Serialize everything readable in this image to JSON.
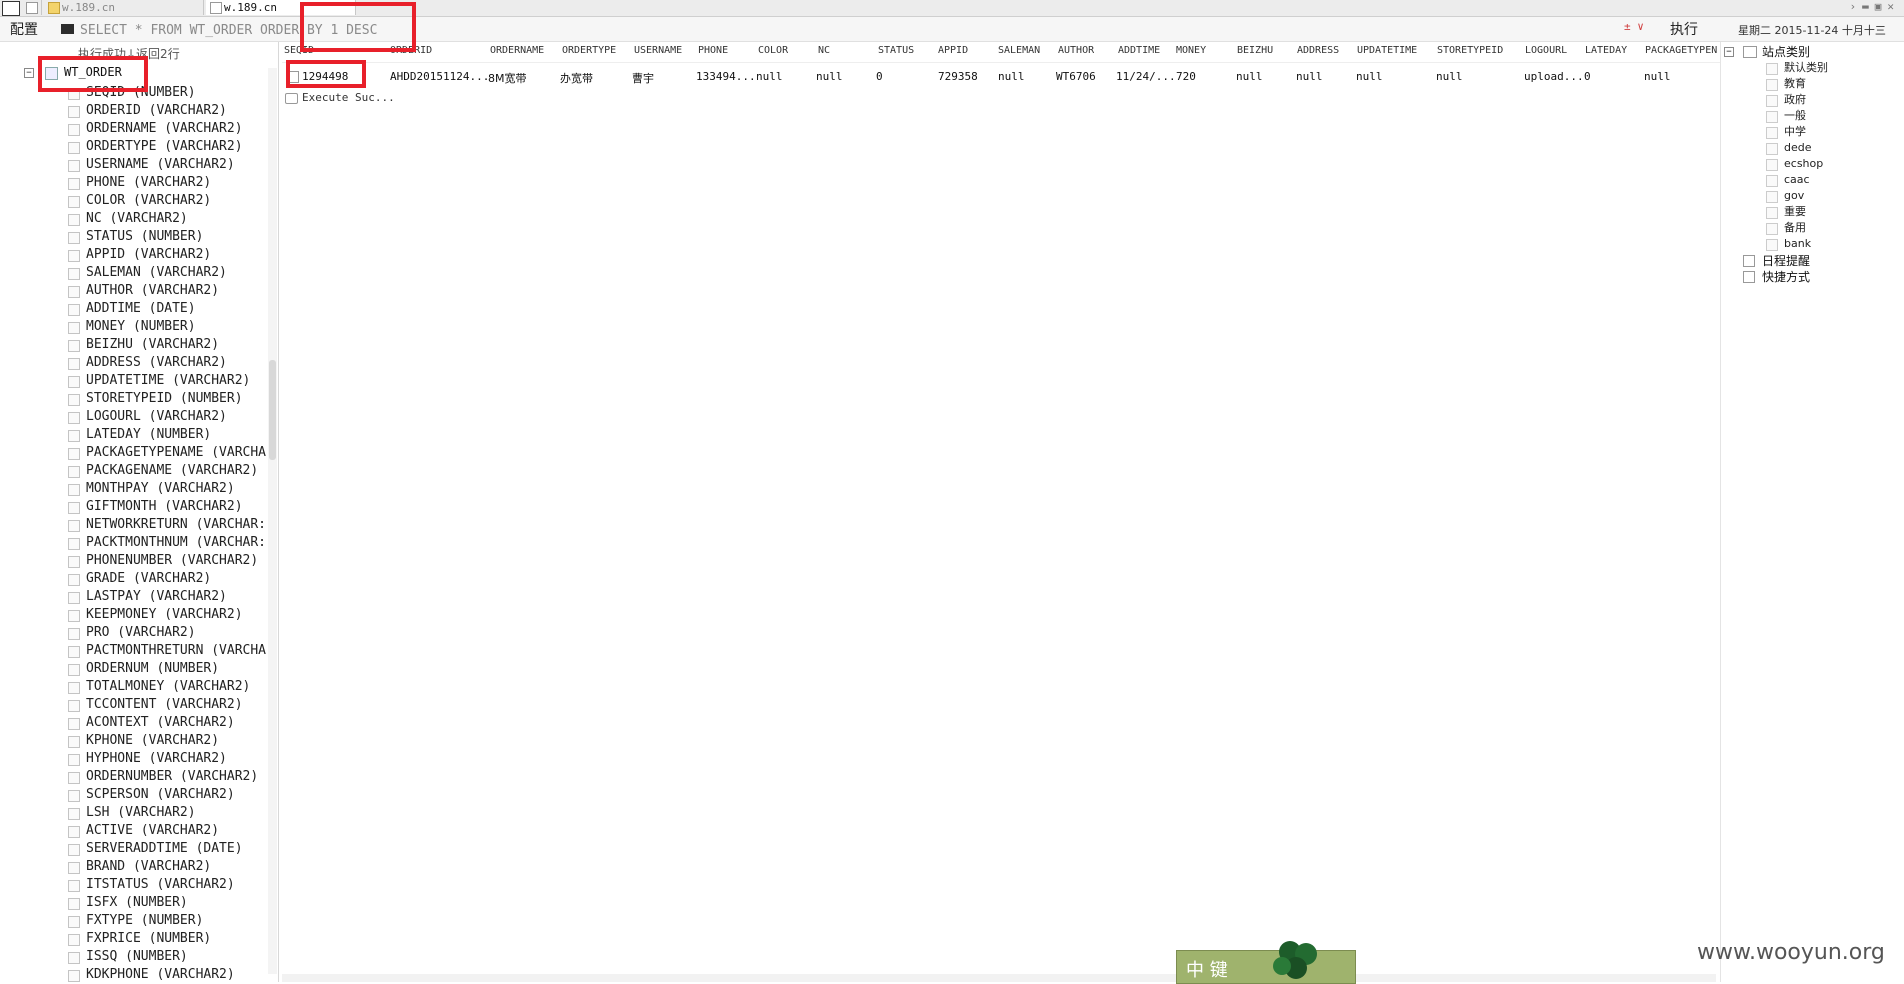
{
  "tabs": [
    {
      "label": "",
      "active": false
    },
    {
      "label": "w.189.cn",
      "active": false
    },
    {
      "label": "w.189.cn",
      "active": true
    }
  ],
  "toolbar": {
    "config_label": "配置",
    "sql_query": "SELECT * FROM WT_ORDER ORDER BY 1 DESC",
    "sql_controls": "± ∨",
    "execute_label": "执行",
    "datetime": "星期二  2015-11-24  十月十三"
  },
  "left_panel": {
    "status": "执行成功↓返回2行",
    "table_name": "WT_ORDER",
    "columns": [
      "SEQID  (NUMBER)",
      "ORDERID  (VARCHAR2)",
      "ORDERNAME  (VARCHAR2)",
      "ORDERTYPE  (VARCHAR2)",
      "USERNAME  (VARCHAR2)",
      "PHONE  (VARCHAR2)",
      "COLOR  (VARCHAR2)",
      "NC  (VARCHAR2)",
      "STATUS  (NUMBER)",
      "APPID  (VARCHAR2)",
      "SALEMAN  (VARCHAR2)",
      "AUTHOR  (VARCHAR2)",
      "ADDTIME  (DATE)",
      "MONEY  (NUMBER)",
      "BEIZHU  (VARCHAR2)",
      "ADDRESS  (VARCHAR2)",
      "UPDATETIME  (VARCHAR2)",
      "STORETYPEID  (NUMBER)",
      "LOGOURL  (VARCHAR2)",
      "LATEDAY  (NUMBER)",
      "PACKAGETYPENAME  (VARCHA",
      "PACKAGENAME  (VARCHAR2)",
      "MONTHPAY  (VARCHAR2)",
      "GIFTMONTH  (VARCHAR2)",
      "NETWORKRETURN  (VARCHAR:",
      "PACKTMONTHNUM  (VARCHAR:",
      "PHONENUMBER  (VARCHAR2)",
      "GRADE  (VARCHAR2)",
      "LASTPAY  (VARCHAR2)",
      "KEEPMONEY  (VARCHAR2)",
      "PRO  (VARCHAR2)",
      "PACTMONTHRETURN  (VARCHA",
      "ORDERNUM  (NUMBER)",
      "TOTALMONEY  (VARCHAR2)",
      "TCCONTENT  (VARCHAR2)",
      "ACONTEXT  (VARCHAR2)",
      "KPHONE  (VARCHAR2)",
      "HYPHONE  (VARCHAR2)",
      "ORDERNUMBER  (VARCHAR2)",
      "SCPERSON  (VARCHAR2)",
      "LSH  (VARCHAR2)",
      "ACTIVE  (VARCHAR2)",
      "SERVERADDTIME  (DATE)",
      "BRAND  (VARCHAR2)",
      "ITSTATUS  (VARCHAR2)",
      "ISFX  (NUMBER)",
      "FXTYPE  (NUMBER)",
      "FXPRICE  (NUMBER)",
      "ISSQ  (NUMBER)",
      "KDKPHONE  (VARCHAR2)"
    ]
  },
  "grid": {
    "headers": [
      "SEQID",
      "ORDERID",
      "ORDERNAME",
      "ORDERTYPE",
      "USERNAME",
      "PHONE",
      "COLOR",
      "NC",
      "STATUS",
      "APPID",
      "SALEMAN",
      "AUTHOR",
      "ADDTIME",
      "MONEY",
      "BEIZHU",
      "ADDRESS",
      "UPDATETIME",
      "STORETYPEID",
      "LOGOURL",
      "LATEDAY",
      "PACKAGETYPEN"
    ],
    "row": [
      "1294498",
      "AHDD20151124...",
      "8M宽带",
      "办宽带",
      "曹宇",
      "133494...",
      "null",
      "null",
      "0",
      "729358",
      "null",
      "WT6706",
      "11/24/...",
      "720",
      "null",
      "null",
      "null",
      "null",
      "upload...",
      "0",
      "null"
    ],
    "exec_row": "Execute Suc..."
  },
  "right_panel": {
    "category_title": "站点类别",
    "categories": [
      "默认类别",
      "教育",
      "政府",
      "一般",
      "中学",
      "dede",
      "ecshop",
      "caac",
      "gov",
      "重要",
      "备用",
      "bank"
    ],
    "schedule": "日程提醒",
    "shortcut": "快捷方式"
  },
  "overlay": {
    "popup_text": "中 键",
    "watermark": "www.wooyun.org"
  },
  "colors": {
    "highlight": "#e8202a",
    "popup": "#9fb36d"
  }
}
